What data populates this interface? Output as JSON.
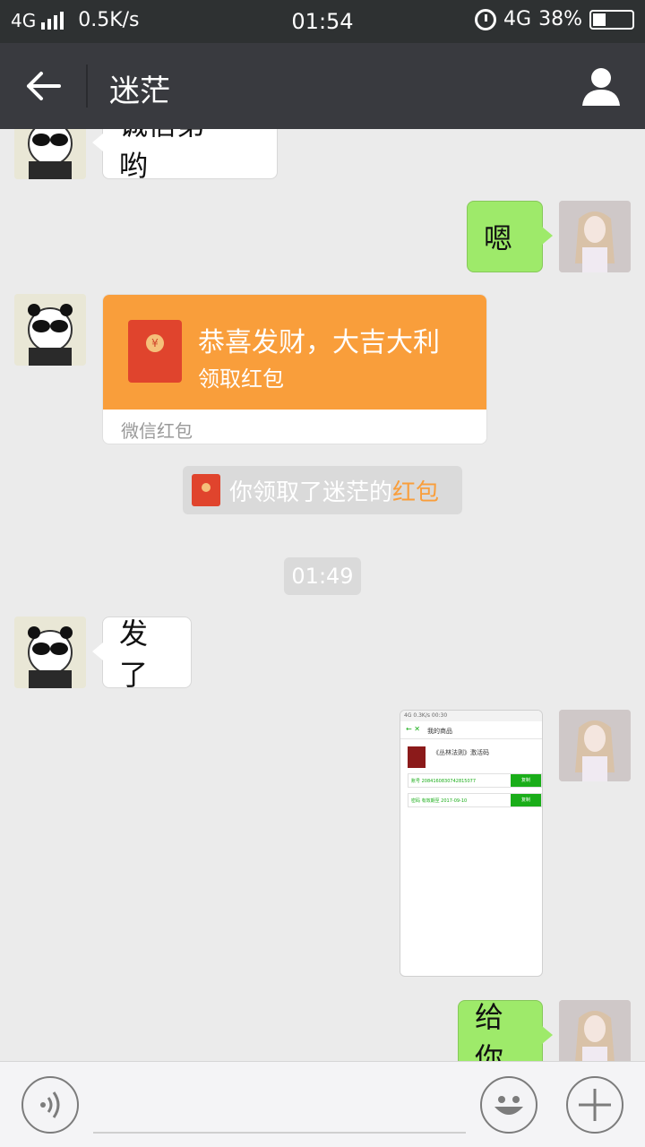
{
  "status_bar": {
    "network": "4G",
    "speed": "0.5K/s",
    "time": "01:54",
    "net_right": "4G",
    "battery": "38%"
  },
  "header": {
    "title": "迷茫",
    "back_icon": "back-arrow-icon",
    "profile_icon": "person-icon"
  },
  "messages": {
    "m1": "诚信第一哟",
    "m2": "嗯",
    "red_packet": {
      "title": "恭喜发财，大吉大利",
      "subtitle": "领取红包",
      "footer": "微信红包"
    },
    "notice": {
      "prefix": "你领取了迷茫的",
      "highlight": "红包"
    },
    "time": "01:49",
    "m3": "发了",
    "image": {
      "status": "4G  0.3K/s      00:30",
      "header": "我的商品",
      "product_title": "《丛林法则》激活码",
      "row1": "账号  2084160830742815077",
      "row2": "密码  有效期至 2017-09-10",
      "copy_label": "复制"
    },
    "m4": "给你"
  },
  "input_bar": {
    "placeholder": ""
  },
  "colors": {
    "accent_green": "#9eea6a",
    "red_packet_orange": "#f99e3b",
    "header_bg": "#393a3f"
  }
}
